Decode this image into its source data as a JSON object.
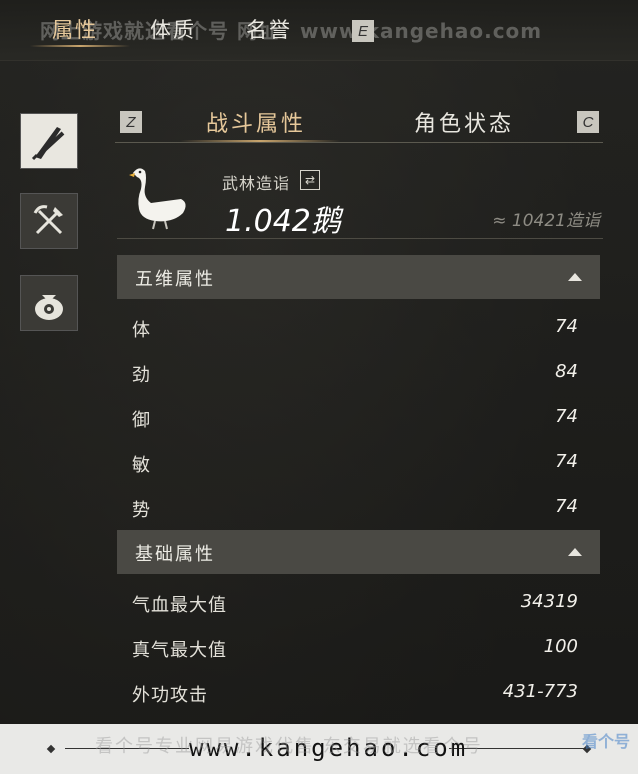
{
  "top_tabs": [
    {
      "label": "属性"
    },
    {
      "label": "体质"
    },
    {
      "label": "名誉"
    }
  ],
  "top_key": "E",
  "watermark_top": "网上游戏就选看个号 网址：www.kangehao.com",
  "sub_tabs": {
    "left_key": "Z",
    "tab1": "战斗属性",
    "tab2": "角色状态",
    "right_key": "C"
  },
  "realm": {
    "label": "武林造诣",
    "value": "1.042鹅",
    "approx": "≈ 10421造诣"
  },
  "sections": [
    {
      "title": "五维属性",
      "rows": [
        {
          "label": "体",
          "value": "74"
        },
        {
          "label": "劲",
          "value": "84"
        },
        {
          "label": "御",
          "value": "74"
        },
        {
          "label": "敏",
          "value": "74"
        },
        {
          "label": "势",
          "value": "74"
        }
      ]
    },
    {
      "title": "基础属性",
      "rows": [
        {
          "label": "气血最大值",
          "value": "34319"
        },
        {
          "label": "真气最大值",
          "value": "100"
        },
        {
          "label": "外功攻击",
          "value": "431-773"
        }
      ]
    }
  ],
  "side_icons": [
    "sword-icon",
    "tools-icon",
    "money-bag-icon"
  ],
  "footer": {
    "url": "www.kangehao.com",
    "watermark": "看个号专业网易游戏代售 东交易就选看个号",
    "logo": "看个号"
  }
}
